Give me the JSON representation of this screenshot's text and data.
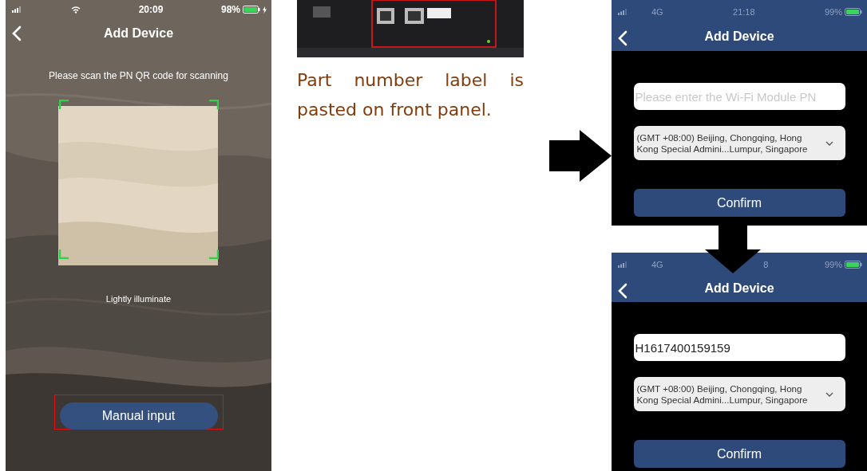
{
  "scan_screen": {
    "status_bar": {
      "time": "20:09",
      "battery": "98%"
    },
    "title": "Add Device",
    "instruction": "Please scan the PN QR code for scanning",
    "hint": "Lightly illuminate",
    "manual_button": "Manual input"
  },
  "caption": "Part number label is pasted on front panel.",
  "form_screens": [
    {
      "status_bar": {
        "network": "4G",
        "time": "21:18",
        "battery": "99%"
      },
      "title": "Add Device",
      "pn_field": {
        "placeholder": "Please enter the Wi-Fi Module PN"
      },
      "timezone": "(GMT +08:00) Beijing, Chongqing, Hong Kong Special Admini...Lumpur, Singapore",
      "confirm": "Confirm"
    },
    {
      "status_bar": {
        "network": "4G",
        "time": "8",
        "battery": "99%"
      },
      "title": "Add Device",
      "pn_field": {
        "value": "H1617400159159"
      },
      "timezone": "(GMT +08:00) Beijing, Chongqing, Hong Kong Special Admini...Lumpur, Singapore",
      "confirm": "Confirm"
    }
  ]
}
